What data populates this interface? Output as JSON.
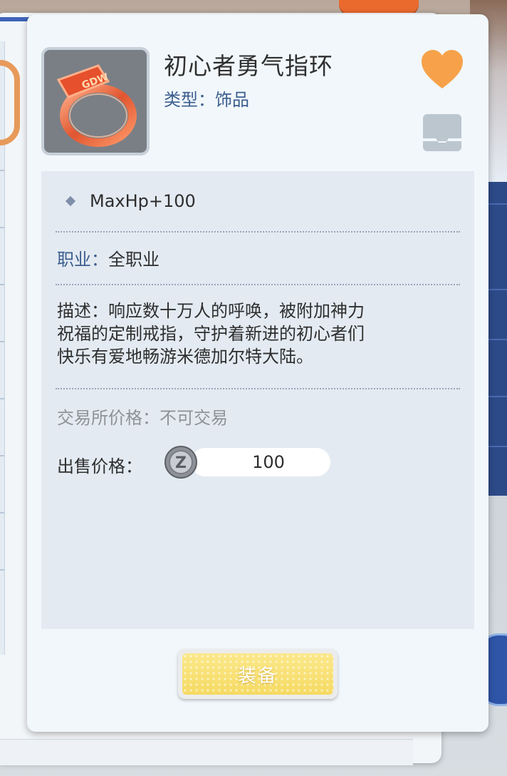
{
  "item": {
    "name": "初心者勇气指环",
    "type_label": "类型：",
    "type_value": "饰品",
    "ring_engraving": "GDW"
  },
  "stats": [
    "MaxHp+100"
  ],
  "job": {
    "label": "职业：",
    "value": "全职业"
  },
  "description": {
    "lines": [
      "描述：响应数十万人的呼唤，被附加神力",
      "祝福的定制戒指，守护着新进的初心者们",
      "快乐有爱地畅游米德加尔特大陆。"
    ]
  },
  "exchange": {
    "label": "交易所价格：",
    "value": "不可交易"
  },
  "sell": {
    "label": "出售价格：",
    "value": "100",
    "currency_icon": "zeny-coin-icon"
  },
  "actions": {
    "equip_label": "装备"
  },
  "icons": {
    "favorite": "heart-icon",
    "storage": "tray-icon"
  },
  "colors": {
    "accent_blue": "#3b5e8e",
    "heart": "#f7a24a",
    "equip_button": "#f7dd6a",
    "card_bg": "#f1f7fb",
    "detail_bg": "#e3eaf2"
  }
}
